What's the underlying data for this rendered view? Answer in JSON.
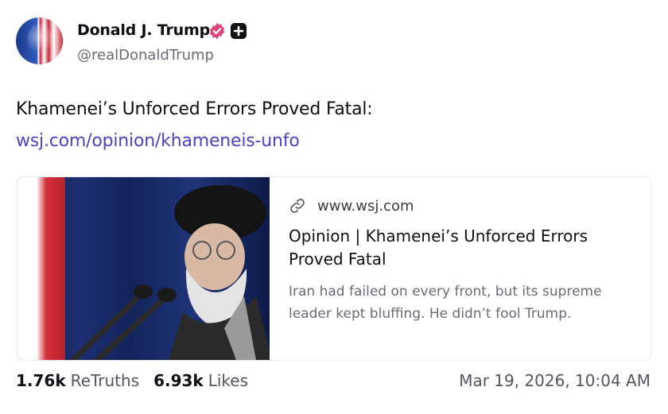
{
  "author": {
    "name": "Donald J. Trump",
    "handle": "@realDonaldTrump",
    "verified_color": "#e0457b"
  },
  "post": {
    "text": "Khamenei’s Unforced Errors Proved Fatal:",
    "link_text": "wsj.com/opinion/khameneis-unfo"
  },
  "link_card": {
    "domain": "www.wsj.com",
    "title": "Opinion | Khamenei’s Unforced Errors Proved Fatal",
    "description": "Iran had failed on every front, but its supreme leader kept bluffing. He didn’t fool Trump."
  },
  "stats": {
    "retruths_count": "1.76k",
    "retruths_label": "ReTruths",
    "likes_count": "6.93k",
    "likes_label": "Likes"
  },
  "timestamp": "Mar 19, 2026, 10:04 AM",
  "colors": {
    "link": "#4a44c6",
    "muted": "#6b6b76"
  }
}
